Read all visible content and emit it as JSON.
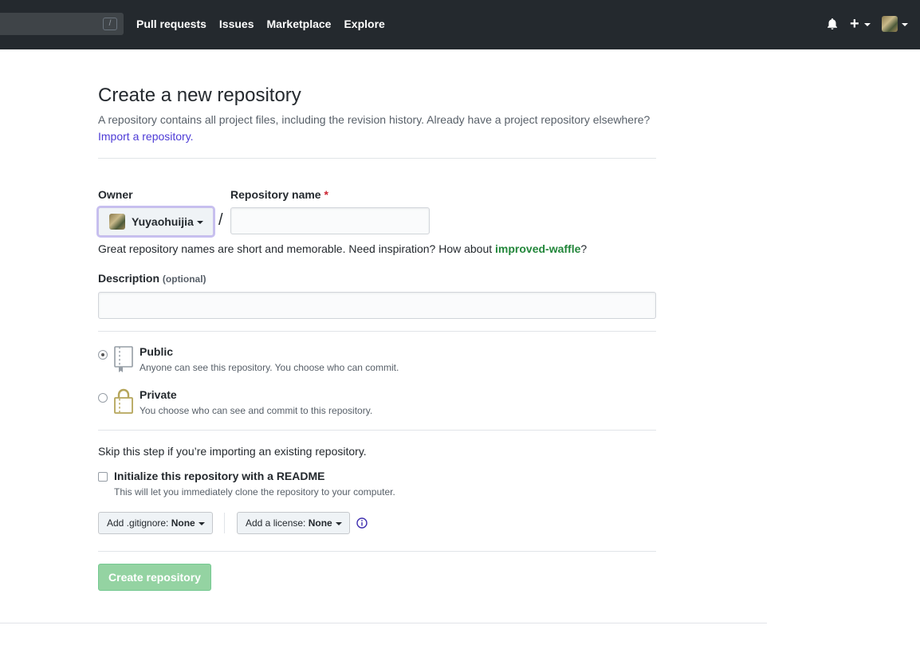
{
  "header": {
    "search_shortcut": "/",
    "nav": [
      "Pull requests",
      "Issues",
      "Marketplace",
      "Explore"
    ],
    "icons": [
      "bell-icon",
      "plus-icon",
      "avatar"
    ]
  },
  "page": {
    "title": "Create a new repository",
    "subtitle": "A repository contains all project files, including the revision history. Already have a project repository elsewhere?",
    "import_link": "Import a repository."
  },
  "form": {
    "owner_label": "Owner",
    "owner_name": "Yuyaohuijia",
    "repo_name_label": "Repository name",
    "required_mark": "*",
    "slash": "/",
    "repo_name_value": "",
    "hint_prefix": "Great repository names are short and memorable. Need inspiration? How about ",
    "hint_suggestion": "improved-waffle",
    "hint_suffix": "?",
    "description_label": "Description",
    "description_optional": "(optional)",
    "description_value": "",
    "visibility": [
      {
        "title": "Public",
        "desc": "Anyone can see this repository. You choose who can commit.",
        "checked": true
      },
      {
        "title": "Private",
        "desc": "You choose who can see and commit to this repository.",
        "checked": false
      }
    ],
    "skip_text": "Skip this step if you’re importing an existing repository.",
    "readme_title": "Initialize this repository with a README",
    "readme_desc": "This will let you immediately clone the repository to your computer.",
    "readme_checked": false,
    "gitignore_label": "Add .gitignore:",
    "gitignore_value": "None",
    "license_label": "Add a license:",
    "license_value": "None",
    "create_button": "Create repository"
  },
  "colors": {
    "header_bg": "#24292e",
    "suggestion": "#22863a",
    "link": "#4d3bd6",
    "create_button_bg": "#94d3a2",
    "required": "#cb2431",
    "private_lock": "#b5a55a"
  }
}
